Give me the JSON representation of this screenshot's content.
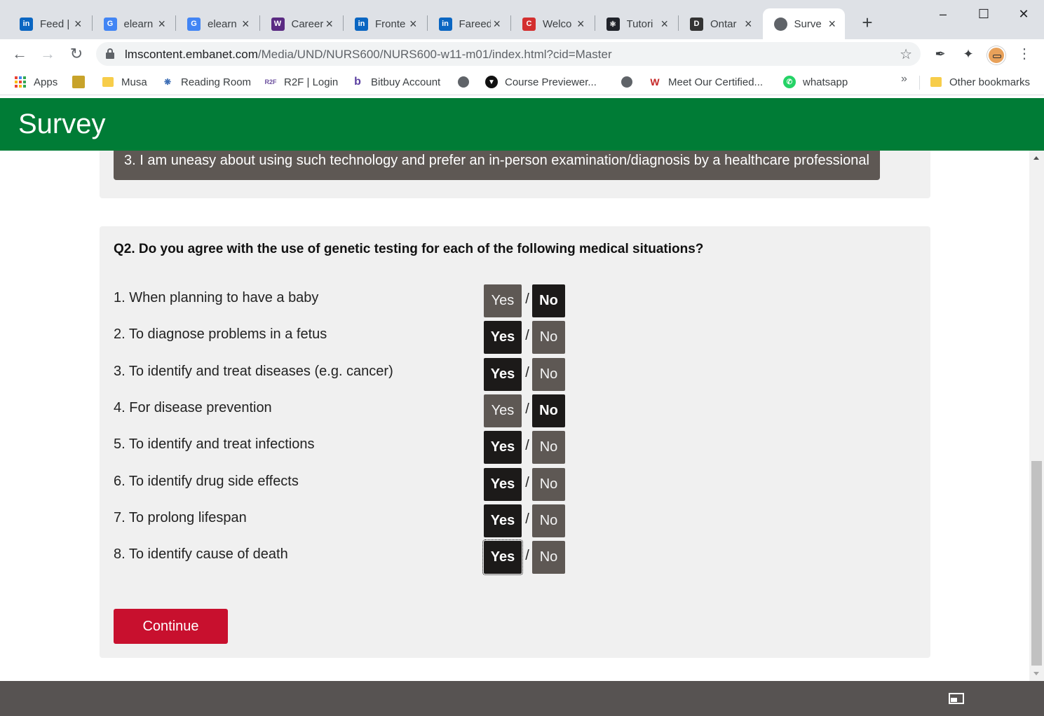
{
  "browser": {
    "tabs": [
      {
        "title": "Feed |",
        "icon": "linkedin-icon",
        "color": "#0a66c2",
        "glyph": "in"
      },
      {
        "title": "elearn",
        "icon": "google-icon",
        "color": "#4285f4",
        "glyph": "G"
      },
      {
        "title": "elearn",
        "icon": "google-icon",
        "color": "#4285f4",
        "glyph": "G"
      },
      {
        "title": "Career",
        "icon": "university-crest-icon",
        "color": "#5a2a82",
        "glyph": "W"
      },
      {
        "title": "Fronte",
        "icon": "linkedin-icon",
        "color": "#0a66c2",
        "glyph": "in"
      },
      {
        "title": "Fareed",
        "icon": "linkedin-icon",
        "color": "#0a66c2",
        "glyph": "in"
      },
      {
        "title": "Welco",
        "icon": "c-brand-icon",
        "color": "#d32f2f",
        "glyph": "C"
      },
      {
        "title": "Tutori",
        "icon": "react-icon",
        "color": "#20232a",
        "glyph": "⚛"
      },
      {
        "title": "Ontar",
        "icon": "dms-icon",
        "color": "#333333",
        "glyph": "D"
      },
      {
        "title": "Surve",
        "icon": "globe-icon",
        "color": "#5f6368",
        "glyph": "",
        "active": true
      }
    ],
    "url_host": "lmscontent.embanet.com",
    "url_path": "/Media/UND/NURS600/NURS600-w11-m01/index.html?cid=Master",
    "bookmarks": [
      {
        "label": "Apps",
        "icon": "apps-grid-icon"
      },
      {
        "label": "",
        "icon": "bookmark-favicon-icon"
      },
      {
        "label": "Musa",
        "icon": "folder-icon"
      },
      {
        "label": "Reading Room",
        "icon": "reading-room-icon"
      },
      {
        "label": "R2F | Login",
        "icon": "r2f-icon"
      },
      {
        "label": "Bitbuy Account",
        "icon": "bitbuy-icon"
      },
      {
        "label": "",
        "icon": "globe-icon"
      },
      {
        "label": "Course Previewer...",
        "icon": "course-previewer-icon"
      },
      {
        "label": "",
        "icon": "globe-icon"
      },
      {
        "label": "Meet Our Certified...",
        "icon": "certified-icon"
      },
      {
        "label": "whatsapp",
        "icon": "whatsapp-icon"
      }
    ],
    "bookmarks_more": "»",
    "other_bookmarks": "Other bookmarks"
  },
  "page": {
    "header_title": "Survey",
    "previous_option": "3. I am uneasy about using such technology and prefer an in-person examination/diagnosis by a healthcare professional",
    "question_title": "Q2. Do you agree with the use of genetic testing for each of the following medical situations?",
    "yes_label": "Yes",
    "no_label": "No",
    "separator": "/",
    "items": [
      {
        "label": "1. When planning to have a baby",
        "selected": "No"
      },
      {
        "label": "2. To diagnose problems in a fetus",
        "selected": "Yes"
      },
      {
        "label": "3. To identify and treat diseases (e.g. cancer)",
        "selected": "Yes"
      },
      {
        "label": "4. For disease prevention",
        "selected": "No"
      },
      {
        "label": "5. To identify and treat infections",
        "selected": "Yes"
      },
      {
        "label": "6. To identify drug side effects",
        "selected": "Yes"
      },
      {
        "label": "7. To prolong lifespan",
        "selected": "Yes"
      },
      {
        "label": "8. To identify cause of death",
        "selected": "Yes"
      }
    ],
    "continue_label": "Continue"
  },
  "colors": {
    "header_green": "#007c36",
    "continue_red": "#c8102e",
    "option_selected": "#1c1a19",
    "option_unselected": "#5e5854"
  }
}
